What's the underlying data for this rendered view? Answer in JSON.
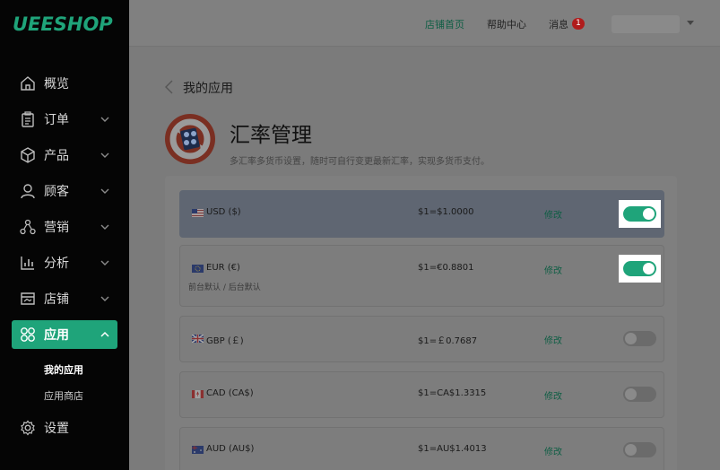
{
  "brand": {
    "logo_text": "UEESHOP",
    "accent": "#1fa47a"
  },
  "topbar": {
    "links": [
      {
        "label": "店铺首页",
        "active": true
      },
      {
        "label": "帮助中心",
        "active": false
      },
      {
        "label": "消息",
        "active": false
      }
    ],
    "message_count": "1",
    "user_name": ""
  },
  "sidebar": {
    "items": [
      {
        "label": "概览",
        "icon": "home-icon",
        "has_children": false
      },
      {
        "label": "订单",
        "icon": "clipboard-icon",
        "has_children": true
      },
      {
        "label": "产品",
        "icon": "box-icon",
        "has_children": true
      },
      {
        "label": "顾客",
        "icon": "user-icon",
        "has_children": true
      },
      {
        "label": "营销",
        "icon": "share-icon",
        "has_children": true
      },
      {
        "label": "分析",
        "icon": "bar-chart-icon",
        "has_children": true
      },
      {
        "label": "店铺",
        "icon": "store-icon",
        "has_children": true
      },
      {
        "label": "应用",
        "icon": "apps-icon",
        "has_children": true,
        "active": true
      },
      {
        "label": "设置",
        "icon": "gear-icon",
        "has_children": false
      }
    ],
    "sub_items": [
      {
        "label": "我的应用",
        "current": true
      },
      {
        "label": "应用商店",
        "current": false
      }
    ]
  },
  "main": {
    "breadcrumb": "我的应用",
    "title": "汇率管理",
    "description": "多汇率多货币设置，随时可自行变更最新汇率，实现多货币支付。",
    "edit_label": "修改",
    "currencies": [
      {
        "name": "USD ($)",
        "rate": "$1=$1.0000",
        "enabled": true,
        "note": "",
        "flag": "us-flag-icon"
      },
      {
        "name": "EUR (€)",
        "rate": "$1=€0.8801",
        "enabled": true,
        "note": "前台默认 / 后台默认",
        "flag": "eu-flag-icon"
      },
      {
        "name": "GBP (￡)",
        "rate": "$1=￡0.7687",
        "enabled": false,
        "note": "",
        "flag": "uk-flag-icon"
      },
      {
        "name": "CAD (CA$)",
        "rate": "$1=CA$1.3315",
        "enabled": false,
        "note": "",
        "flag": "ca-flag-icon"
      },
      {
        "name": "AUD (AU$)",
        "rate": "$1=AU$1.4013",
        "enabled": false,
        "note": "",
        "flag": "au-flag-icon"
      }
    ]
  }
}
